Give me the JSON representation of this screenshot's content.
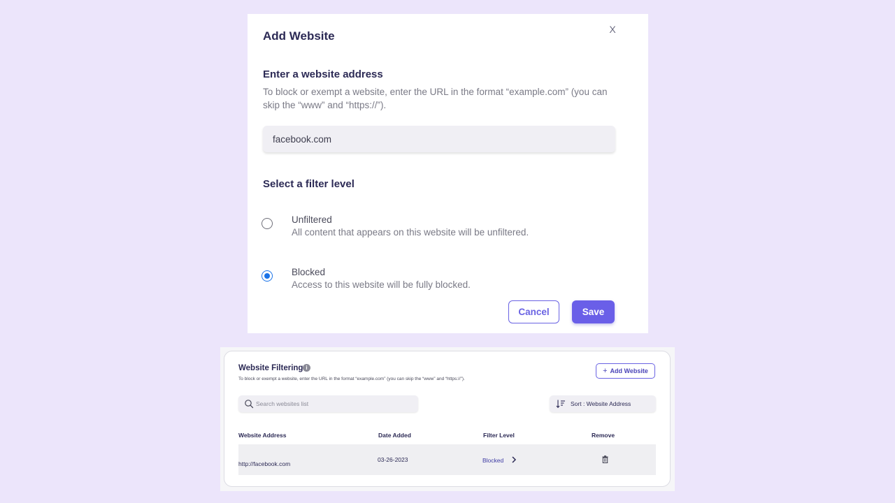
{
  "modal": {
    "title": "Add Website",
    "close_label": "X",
    "address_heading": "Enter a website address",
    "address_help": "To block or exempt a website, enter the URL in the format “example.com” (you can skip the “www” and “https://”).",
    "address_value": "facebook.com",
    "filter_heading": "Select a filter level",
    "options": [
      {
        "title": "Unfiltered",
        "description": "All content that appears on this website will be unfiltered.",
        "selected": false
      },
      {
        "title": "Blocked",
        "description": "Access to this website will be fully blocked.",
        "selected": true
      }
    ],
    "cancel_label": "Cancel",
    "save_label": "Save"
  },
  "panel": {
    "title": "Website Filtering",
    "info_icon": "info-icon",
    "subtitle": "To block or exempt a website, enter the URL in the format “example.com” (you can skip the “www” and “https://”).",
    "add_button_label": "Add Website",
    "search_placeholder": "Search websites list",
    "sort_label": "Sort : Website Address",
    "columns": [
      "Website Address",
      "Date Added",
      "Filter Level",
      "Remove"
    ],
    "rows": [
      {
        "address": "http://facebook.com",
        "date_added": "03-26-2023",
        "filter_level": "Blocked"
      }
    ]
  },
  "colors": {
    "background": "#ece5fb",
    "accent": "#6a5fe8",
    "radio_selected": "#1a73e8"
  }
}
